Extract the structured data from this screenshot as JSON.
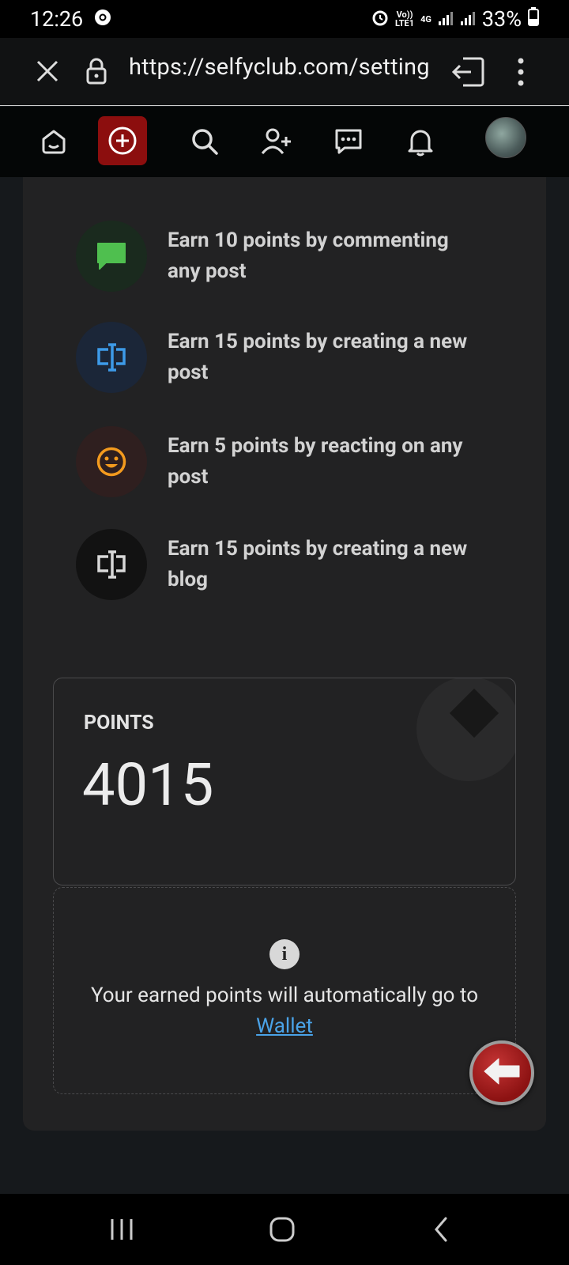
{
  "status_bar": {
    "time": "12:26",
    "net_top": "Vo))",
    "net_bottom": "LTE1",
    "net_type": "4G",
    "battery": "33%"
  },
  "browser": {
    "url": "https://selfyclub.com/setting"
  },
  "earn_list": [
    {
      "text": "Earn 10 points by commenting any post",
      "icon": "comment-icon",
      "color": "#4fbf4f",
      "bg": "#1a2a1e"
    },
    {
      "text": "Earn 15 points by creating a new post",
      "icon": "post-icon",
      "color": "#3d9ae8",
      "bg": "#1b2638"
    },
    {
      "text": "Earn 5 points by reacting on any post",
      "icon": "smiley-icon",
      "color": "#f39a1e",
      "bg": "#2f1f1f"
    },
    {
      "text": "Earn 15 points by creating a new blog",
      "icon": "blog-icon",
      "color": "#d8d8d8",
      "bg": "#121212"
    }
  ],
  "points": {
    "label": "POINTS",
    "value": "4015"
  },
  "info": {
    "text": "Your earned points will automatically go to",
    "link": "Wallet"
  },
  "colors": {
    "accent_red": "#8c0e0e",
    "link_blue": "#4aa3e8"
  }
}
